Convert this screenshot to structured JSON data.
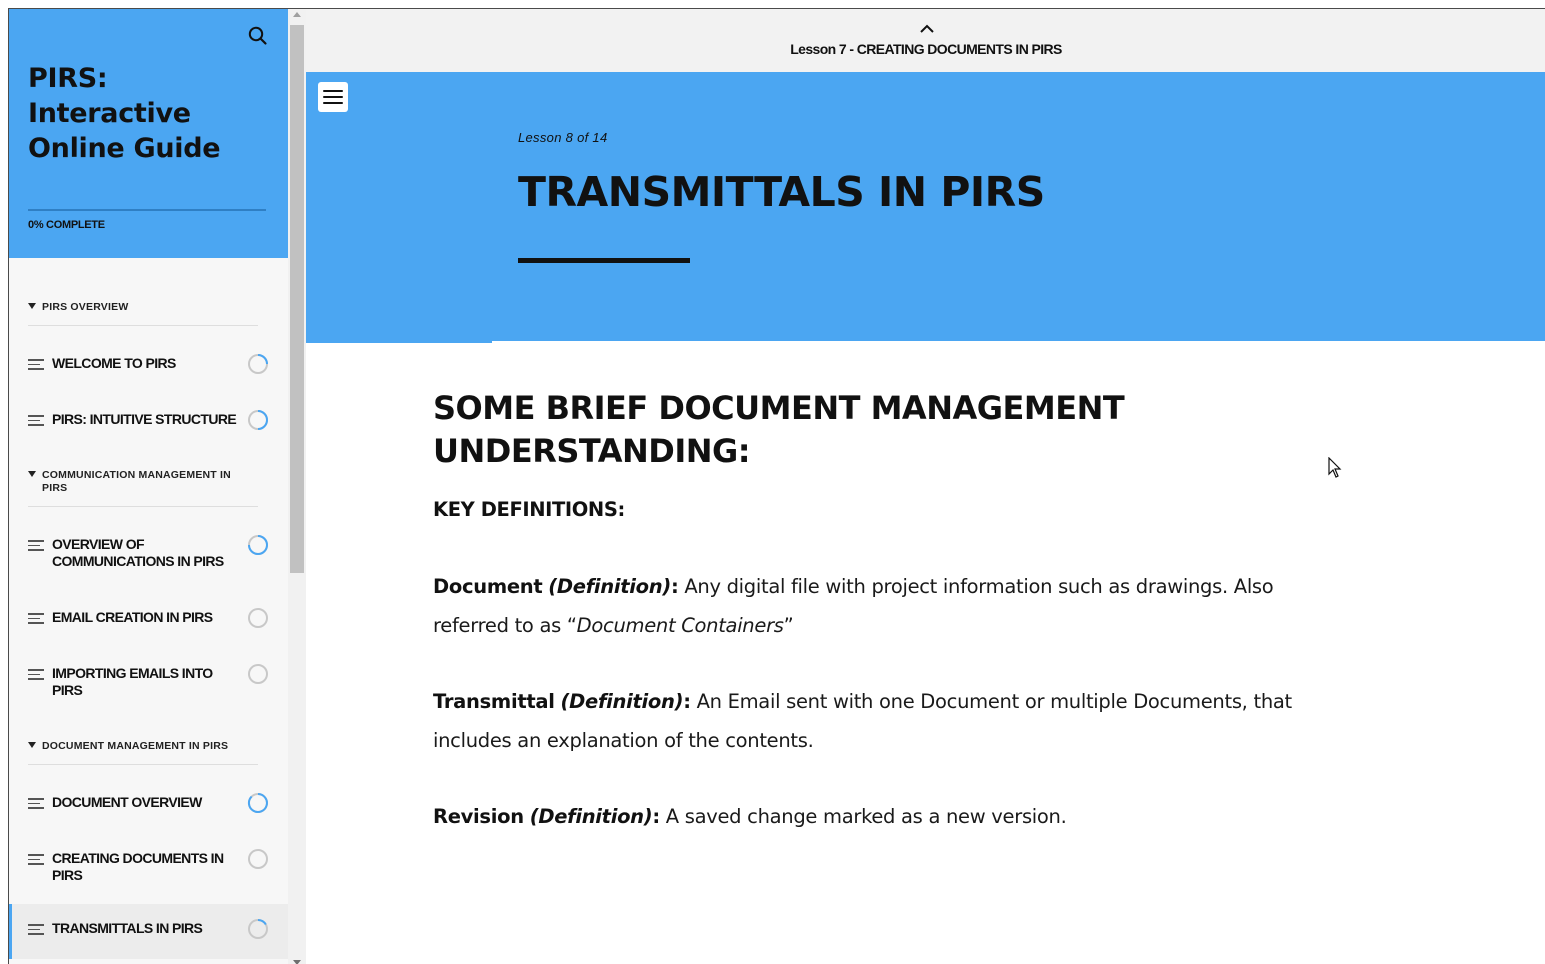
{
  "sidebar": {
    "title": "PIRS: Interactive Online Guide",
    "progress_text": "0% COMPLETE",
    "progress_percent": 0,
    "sections": [
      {
        "label": "PIRS OVERVIEW",
        "items": [
          {
            "label": "WELCOME TO PIRS",
            "status": "in-progress"
          },
          {
            "label": "PIRS: INTUITIVE STRUCTURE",
            "status": "in-progress"
          }
        ]
      },
      {
        "label": "COMMUNICATION MANAGEMENT IN PIRS",
        "items": [
          {
            "label": "OVERVIEW OF COMMUNICATIONS IN PIRS",
            "status": "in-progress"
          },
          {
            "label": "EMAIL CREATION IN PIRS",
            "status": "not-started"
          },
          {
            "label": "IMPORTING EMAILS INTO PIRS",
            "status": "not-started"
          }
        ]
      },
      {
        "label": "DOCUMENT MANAGEMENT IN PIRS",
        "items": [
          {
            "label": "DOCUMENT OVERVIEW",
            "status": "in-progress"
          },
          {
            "label": "CREATING DOCUMENTS IN PIRS",
            "status": "not-started"
          },
          {
            "label": "TRANSMITTALS IN PIRS",
            "status": "in-progress",
            "active": true
          }
        ]
      }
    ]
  },
  "topbar": {
    "previous_lesson": "Lesson 7 - CREATING DOCUMENTS IN PIRS"
  },
  "hero": {
    "lesson_count": "Lesson 8 of 14",
    "title": "TRANSMITTALS IN PIRS"
  },
  "content": {
    "heading": "SOME BRIEF DOCUMENT MANAGEMENT UNDERSTANDING:",
    "subheading": "KEY DEFINITIONS:",
    "definitions": [
      {
        "term": "Document",
        "def_label": "(Definition)",
        "colon": ":",
        "text": "Any digital file with project information such as drawings. Also referred to as “",
        "text_italic": "Document Containers",
        "text_end": "”"
      },
      {
        "term": "Transmittal",
        "def_label": "(Definition)",
        "colon": ":",
        "text": "An Email sent with one Document or multiple Documents, that includes an explanation of the contents."
      },
      {
        "term": "Revision",
        "def_label": "(Definition)",
        "colon": ":",
        "text": "A saved change marked as a new version."
      }
    ]
  },
  "colors": {
    "accent": "#4ba6f2",
    "text": "#111111",
    "sidebar_bg": "#f7f7f7",
    "topbar_bg": "#f2f2f2"
  },
  "icons": {
    "search": "search-icon",
    "menu": "hamburger-menu-icon",
    "chevron": "chevron-up-icon",
    "lesson": "lines-icon",
    "status": "progress-ring-icon"
  }
}
